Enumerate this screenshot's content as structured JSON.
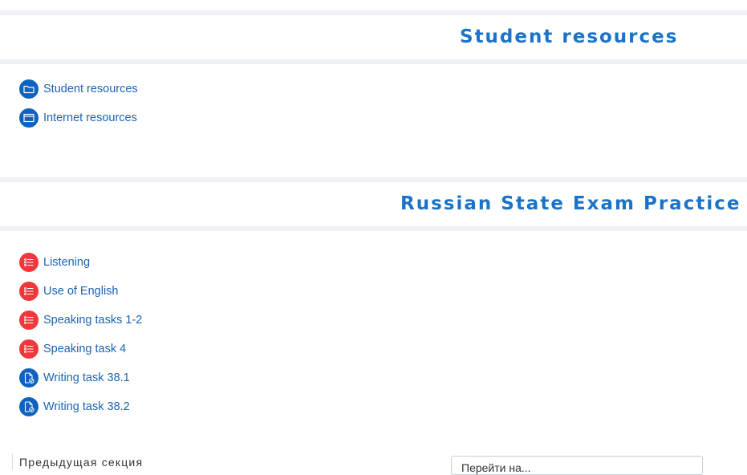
{
  "sections": [
    {
      "title": "Student resources",
      "activities": [
        {
          "label": "Student resources",
          "icon": "folder-icon"
        },
        {
          "label": "Internet resources",
          "icon": "url-icon"
        }
      ]
    },
    {
      "title": "Russian State Exam Practice",
      "activities": [
        {
          "label": "Listening",
          "icon": "quiz-icon"
        },
        {
          "label": "Use of English",
          "icon": "quiz-icon"
        },
        {
          "label": "Speaking tasks 1-2",
          "icon": "quiz-icon"
        },
        {
          "label": "Speaking task 4",
          "icon": "quiz-icon"
        },
        {
          "label": "Writing task 38.1",
          "icon": "assignment-icon"
        },
        {
          "label": "Writing task 38.2",
          "icon": "assignment-icon"
        }
      ]
    }
  ],
  "footer": {
    "prev_section_label": "Предыдущая секция",
    "jump_to_value": "Перейти на..."
  },
  "colors": {
    "title": "#1a73c9",
    "link": "#1a64b4",
    "blue_icon": "#0f62be",
    "red_icon": "#f0373a",
    "band": "#eef2f6"
  }
}
